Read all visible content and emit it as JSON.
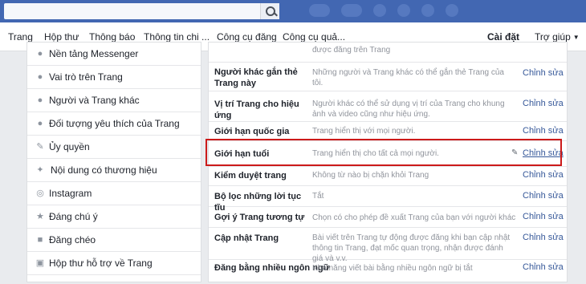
{
  "nav": {
    "tabs": [
      "Trang",
      "Hộp thư",
      "Thông báo",
      "Thông tin chi ...",
      "Công cụ đăng",
      "Công cụ quả..."
    ],
    "settings": "Cài đặt",
    "help": "Trợ giúp"
  },
  "sidebar": {
    "items": [
      {
        "label": "Nền tảng Messenger",
        "icon": "messenger-icon"
      },
      {
        "label": "Vai trò trên Trang",
        "icon": "person-icon"
      },
      {
        "label": "Người và Trang khác",
        "icon": "people-icon"
      },
      {
        "label": "Đối tượng yêu thích của Trang",
        "icon": "people-icon"
      },
      {
        "label": "Ủy quyền",
        "icon": "wrench-icon"
      },
      {
        "label": "Nội dung có thương hiệu",
        "icon": "handshake-icon"
      },
      {
        "label": "Instagram",
        "icon": "instagram-icon"
      },
      {
        "label": "Đáng chú ý",
        "icon": "star-icon"
      },
      {
        "label": "Đăng chéo",
        "icon": "video-icon"
      },
      {
        "label": "Hộp thư hỗ trợ về Trang",
        "icon": "facebook-icon"
      }
    ]
  },
  "main": {
    "top_text": "được đăng trên Trang",
    "edit_label": "Chỉnh sửa",
    "rows": [
      {
        "title": "Người khác gắn thẻ Trang này",
        "desc": "Những người và Trang khác có thể gắn thẻ Trang của tôi."
      },
      {
        "title": "Vị trí Trang cho hiệu ứng",
        "desc": "Người khác có thể sử dụng vị trí của Trang cho khung ảnh và video cũng như hiệu ứng."
      },
      {
        "title": "Giới hạn quốc gia",
        "desc": "Trang hiển thị với mọi người."
      },
      {
        "title": "Giới hạn tuổi",
        "desc": "Trang hiển thị cho tất cả mọi người."
      },
      {
        "title": "Kiểm duyệt trang",
        "desc": "Không từ nào bị chặn khỏi Trang"
      },
      {
        "title": "Bộ lọc những lời tục tĩu",
        "desc": "Tắt"
      },
      {
        "title": "Gợi ý Trang tương tự",
        "desc": "Chọn có cho phép đề xuất Trang của bạn với người khác không"
      },
      {
        "title": "Cập nhật Trang",
        "desc": "Bài viết trên Trang tự động được đăng khi bạn cập nhật thông tin Trang, đạt mốc quan trọng, nhận được đánh giá và v.v."
      },
      {
        "title": "Đăng bằng nhiều ngôn ngữ",
        "desc": "Khả năng viết bài bằng nhiều ngôn ngữ bị tắt"
      }
    ]
  }
}
